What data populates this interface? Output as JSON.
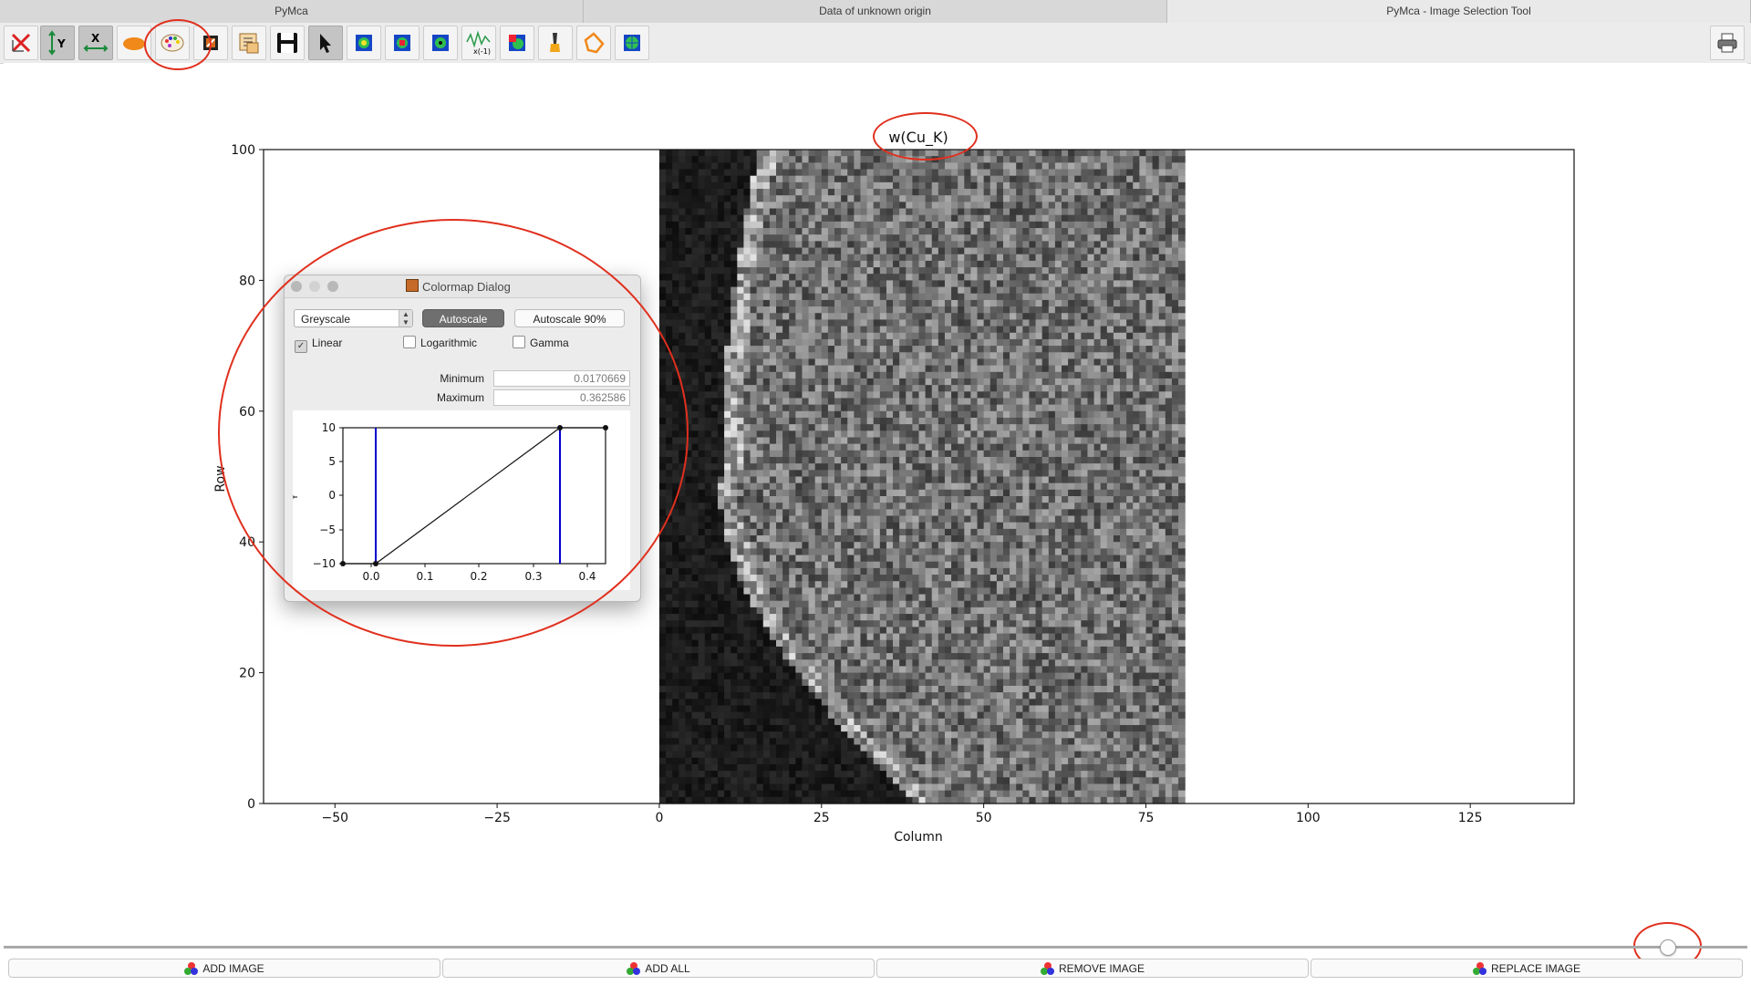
{
  "tabs": [
    {
      "label": "PyMca"
    },
    {
      "label": "Data of unknown origin"
    },
    {
      "label": "PyMca - Image Selection Tool"
    }
  ],
  "toolbar": {
    "icons": [
      "reset-zoom-icon",
      "y-autoscale-icon",
      "x-autoscale-icon",
      "aspect-ratio-icon",
      "colormap-palette-icon",
      "transpose-icon",
      "select-icon",
      "save-icon",
      "arrow-pointer-icon",
      "image-icon",
      "image-rotate-icon",
      "image-flip-icon",
      "derivative-icon",
      "image-filter-icon",
      "brush-icon",
      "polygon-icon",
      "globe-icon",
      "print-icon"
    ]
  },
  "plot": {
    "title": "w(Cu_K)",
    "xlabel": "Column",
    "ylabel": "Row",
    "xticks": [
      "−50",
      "−25",
      "0",
      "25",
      "50",
      "75",
      "100",
      "125"
    ],
    "yticks": [
      "0",
      "20",
      "40",
      "60",
      "80",
      "100"
    ]
  },
  "dialog": {
    "title": "Colormap Dialog",
    "colormap": "Greyscale",
    "autoscale_label": "Autoscale",
    "autoscale90_label": "Autoscale 90%",
    "linear_label": "Linear",
    "log_label": "Logarithmic",
    "gamma_label": "Gamma",
    "linear_checked": true,
    "min_label": "Minimum",
    "max_label": "Maximum",
    "min_value": "0.0170669",
    "max_value": "0.362586",
    "mini_ylabel": "Y",
    "mini_xticks": [
      "0.0",
      "0.1",
      "0.2",
      "0.3",
      "0.4"
    ],
    "mini_yticks": [
      "10",
      "5",
      "0",
      "−5",
      "−10"
    ]
  },
  "slider": {
    "position": 0.95
  },
  "bottom": {
    "add_image": "ADD IMAGE",
    "add_all": "ADD ALL",
    "remove_image": "REMOVE IMAGE",
    "replace_image": "REPLACE IMAGE"
  },
  "colors": {
    "annotation": "#e0301e",
    "vline": "#0000cc"
  }
}
